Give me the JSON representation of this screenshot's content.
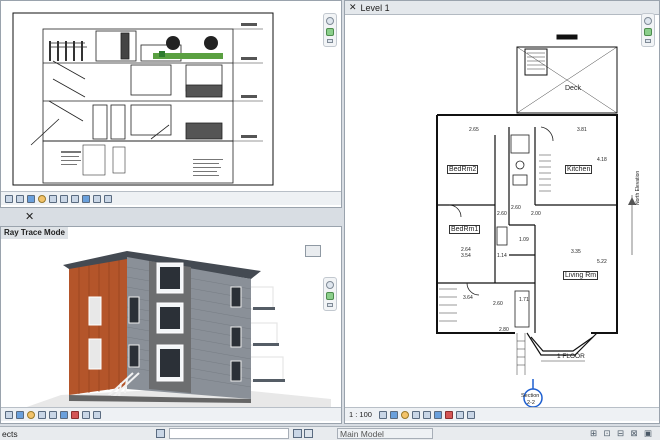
{
  "views": {
    "plan": {
      "title": "Level 1",
      "scale": "1 : 100"
    },
    "render": {
      "mode_label": "Ray Trace Mode"
    }
  },
  "plan_text": {
    "deck": "Deck",
    "bedrm2": "BedRm2",
    "kitchen": "Kitchen",
    "bedrm1": "BedRm1",
    "living": "Living Rm",
    "floor_label": "1 FLOOR",
    "north": "North Elevation",
    "section_title": "Section",
    "section_num": "2-2",
    "dims": [
      "2.65",
      "3.81",
      "4.18",
      "2.60",
      "3.35",
      "3.54",
      "1.14",
      "1.09",
      "2.60",
      "5.22",
      "2.64",
      "3.64",
      "2.60",
      "2.80",
      "1.71",
      "2.00"
    ]
  },
  "status": {
    "left_text": "ects",
    "model": "Main Model"
  },
  "colors": {
    "background": "#d8dde3",
    "siding_wood": "#b4552a",
    "siding_grey": "#8a9098",
    "stone": "#6d6e70",
    "roof": "#444a52",
    "sky": "#ffffff",
    "section_marker": "#1e5fd0"
  }
}
